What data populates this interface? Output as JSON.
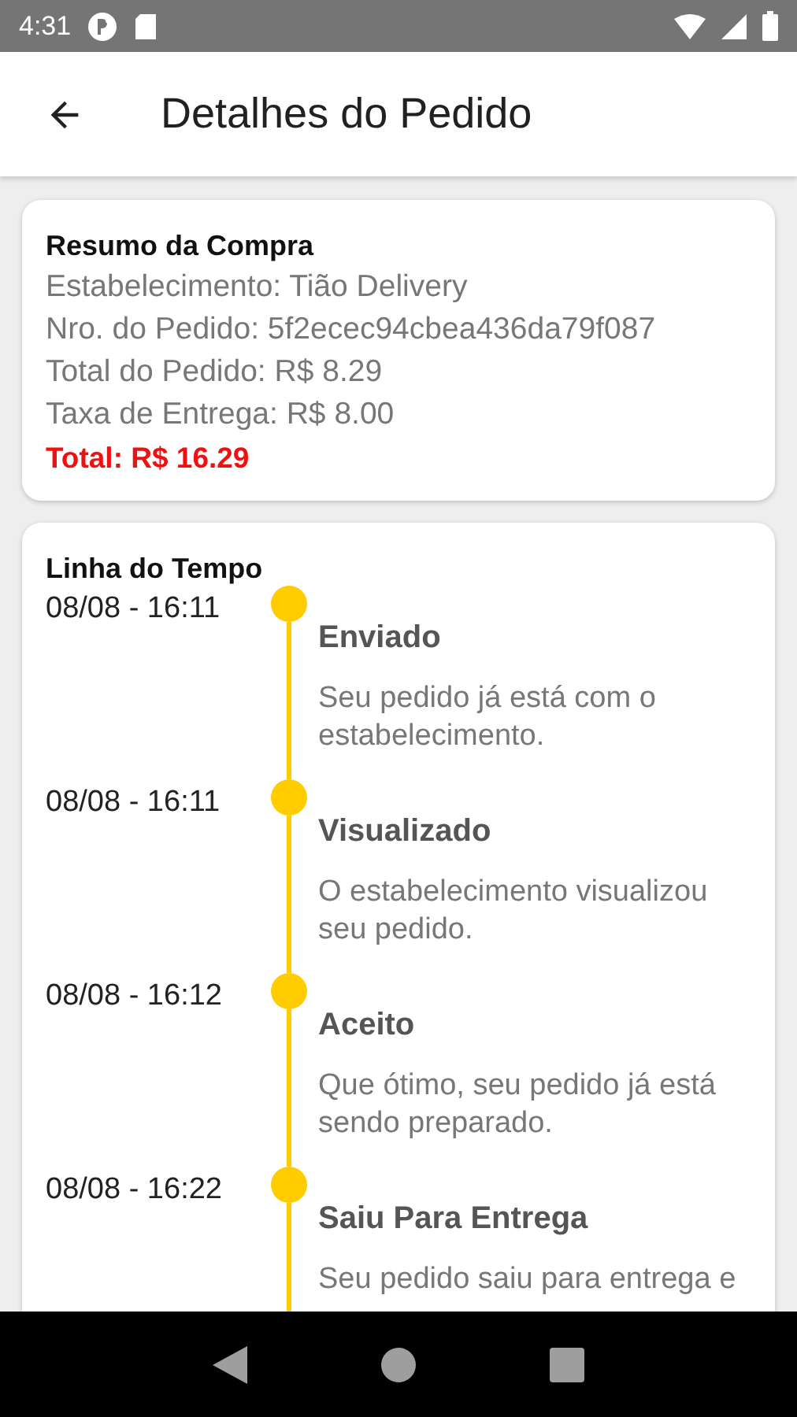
{
  "status_bar": {
    "time": "4:31"
  },
  "app_bar": {
    "title": "Detalhes do Pedido"
  },
  "summary": {
    "title": "Resumo da Compra",
    "lines": [
      "Estabelecimento: Tião Delivery",
      "Nro. do Pedido: 5f2ecec94cbea436da79f087",
      "Total do Pedido: R$ 8.29",
      "Taxa de Entrega: R$ 8.00"
    ],
    "total": "Total: R$ 16.29"
  },
  "timeline": {
    "title": "Linha do Tempo",
    "events": [
      {
        "time": "08/08 - 16:11",
        "status": "Enviado",
        "description": "Seu pedido já está com o estabelecimento."
      },
      {
        "time": "08/08 - 16:11",
        "status": "Visualizado",
        "description": "O estabelecimento visualizou seu pedido."
      },
      {
        "time": "08/08 - 16:12",
        "status": "Aceito",
        "description": "Que ótimo, seu pedido já está sendo preparado."
      },
      {
        "time": "08/08 - 16:22",
        "status": "Saiu Para Entrega",
        "description": "Seu pedido saiu para entrega e"
      }
    ]
  }
}
